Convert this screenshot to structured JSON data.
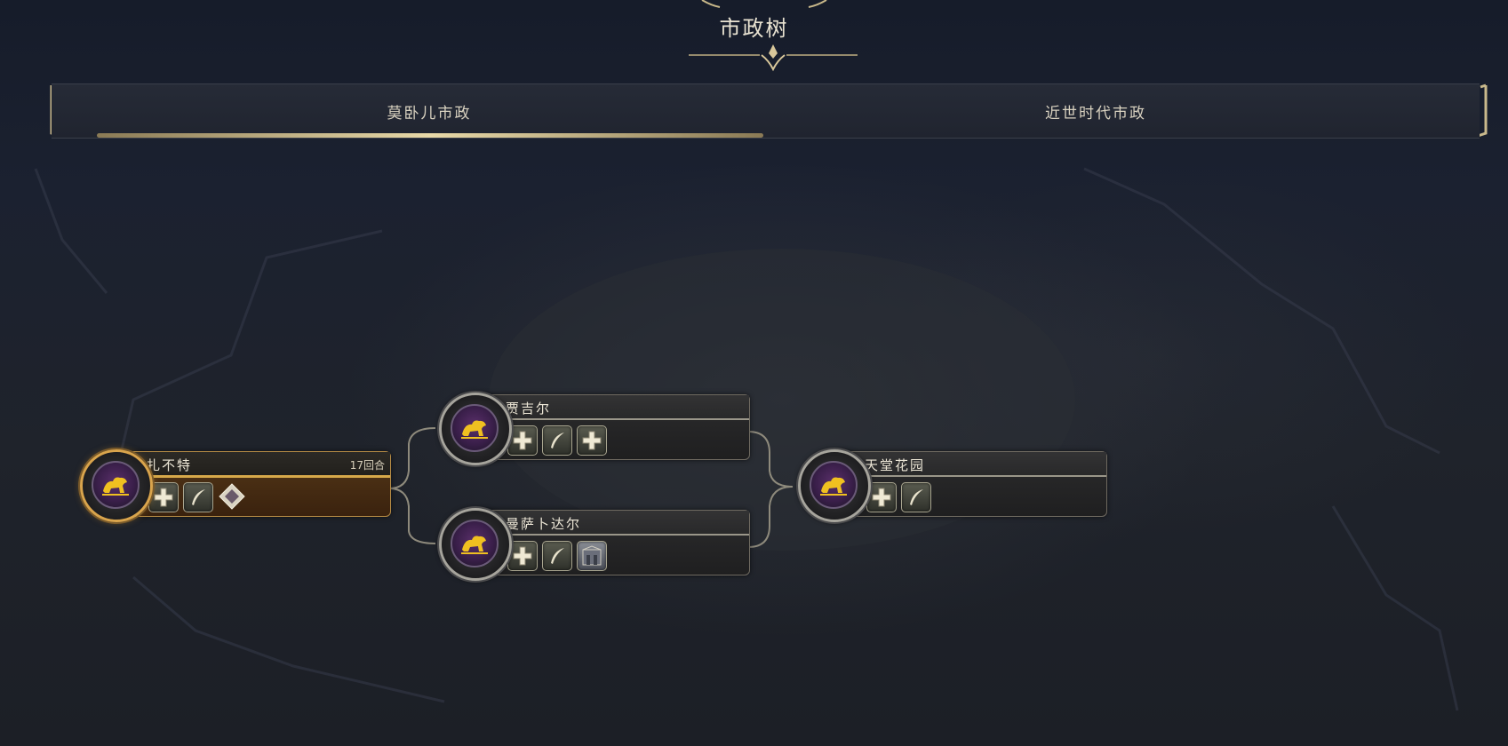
{
  "header": {
    "title": "市政树"
  },
  "tabs": [
    {
      "label": "莫卧儿市政",
      "active": true
    },
    {
      "label": "近世时代市政",
      "active": false
    }
  ],
  "nodes": {
    "zabut": {
      "name": "扎不特",
      "turns": "17回合",
      "icons": [
        "plus-icon",
        "feather-icon",
        "gem-icon"
      ],
      "state": "researching"
    },
    "jagir": {
      "name": "贾吉尔",
      "icons": [
        "plus-icon",
        "feather-icon",
        "plus-icon"
      ]
    },
    "mansabdar": {
      "name": "曼萨卜达尔",
      "icons": [
        "plus-icon",
        "feather-icon",
        "building-icon"
      ]
    },
    "paradise": {
      "name": "天堂花园",
      "icons": [
        "plus-icon",
        "feather-icon"
      ]
    }
  },
  "colors": {
    "accent_gold": "#d7a94a",
    "panel_dark": "#262627",
    "medal_purple": "#5a2f6a"
  }
}
